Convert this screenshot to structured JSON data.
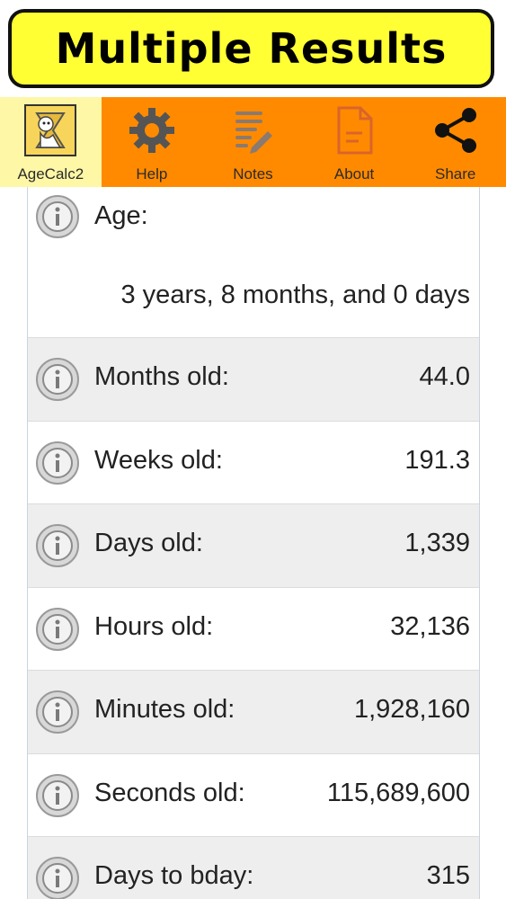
{
  "banner": {
    "title": "Multiple Results",
    "background": "#ffff33"
  },
  "toolbar": {
    "background": "#ff8a00",
    "items": [
      {
        "label": "AgeCalc2",
        "icon": "app-logo-icon"
      },
      {
        "label": "Help",
        "icon": "gear-icon"
      },
      {
        "label": "Notes",
        "icon": "notes-icon"
      },
      {
        "label": "About",
        "icon": "document-icon"
      },
      {
        "label": "Share",
        "icon": "share-icon"
      }
    ]
  },
  "results": [
    {
      "label": "Age:",
      "value": "3 years, 8 months, and 0 days"
    },
    {
      "label": "Months old:",
      "value": "44.0"
    },
    {
      "label": "Weeks old:",
      "value": "191.3"
    },
    {
      "label": "Days old:",
      "value": "1,339"
    },
    {
      "label": "Hours old:",
      "value": "32,136"
    },
    {
      "label": "Minutes old:",
      "value": "1,928,160"
    },
    {
      "label": "Seconds old:",
      "value": "115,689,600"
    },
    {
      "label": "Days to bday:",
      "value": "315"
    }
  ]
}
